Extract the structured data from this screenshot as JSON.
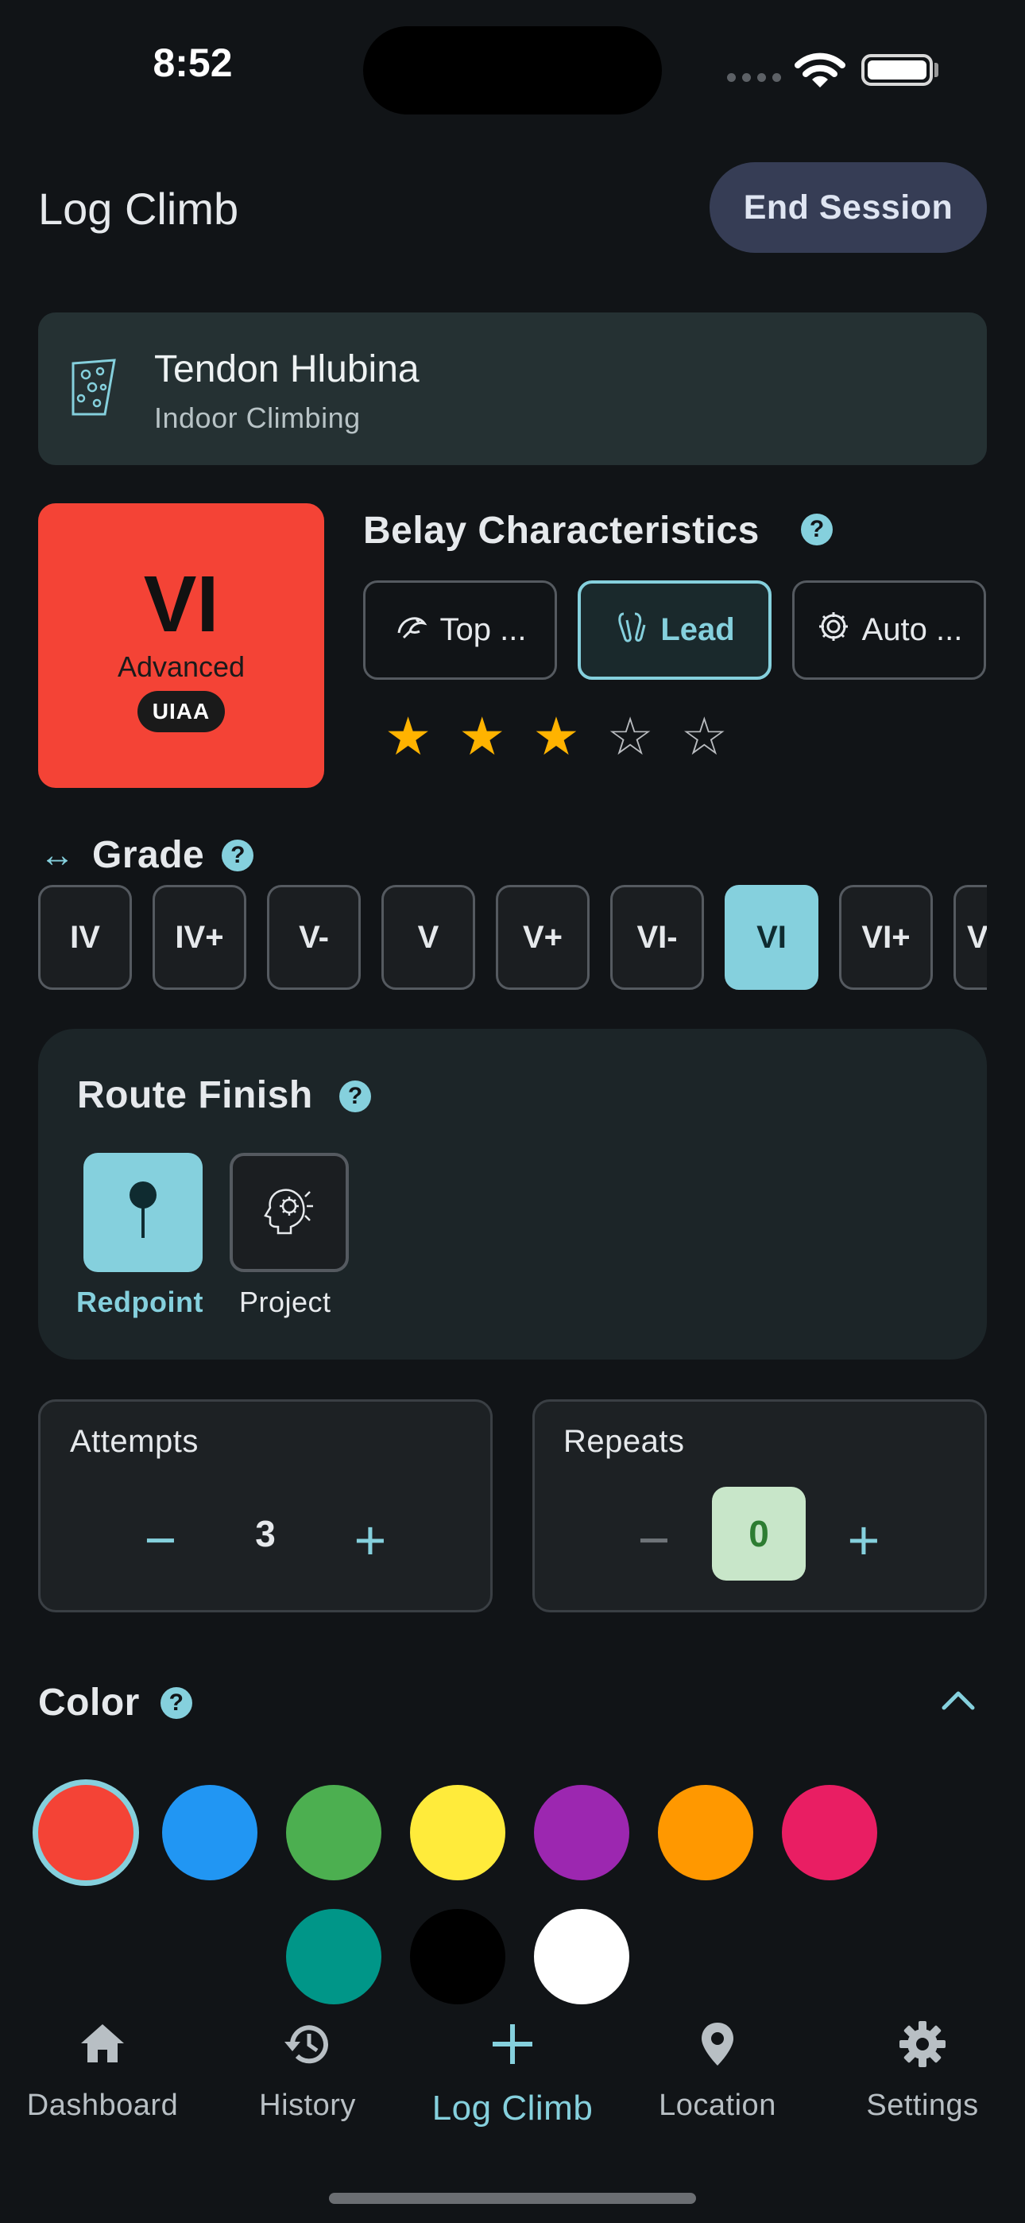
{
  "status_bar": {
    "time": "8:52"
  },
  "header": {
    "title": "Log Climb",
    "end_session_label": "End Session"
  },
  "gym": {
    "name": "Tendon Hlubina",
    "type": "Indoor Climbing"
  },
  "grade_badge": {
    "grade": "VI",
    "level": "Advanced",
    "system": "UIAA",
    "color": "#f44336"
  },
  "belay": {
    "title": "Belay Characteristics",
    "options": [
      {
        "label": "Top ...",
        "icon": "top-rope-icon",
        "selected": false
      },
      {
        "label": "Lead",
        "icon": "lead-icon",
        "selected": true
      },
      {
        "label": "Auto ...",
        "icon": "auto-belay-icon",
        "selected": false
      }
    ],
    "rating": 3,
    "rating_max": 5
  },
  "grade_picker": {
    "label": "Grade",
    "chips": [
      "IV",
      "IV+",
      "V-",
      "V",
      "V+",
      "VI-",
      "VI",
      "VI+",
      "V"
    ],
    "selected": "VI"
  },
  "route_finish": {
    "title": "Route Finish",
    "options": [
      {
        "label": "Redpoint",
        "icon": "pin-icon",
        "selected": true
      },
      {
        "label": "Project",
        "icon": "brain-gear-icon",
        "selected": false
      }
    ]
  },
  "attempts": {
    "label": "Attempts",
    "value": "3"
  },
  "repeats": {
    "label": "Repeats",
    "value": "0"
  },
  "colors": {
    "title": "Color",
    "swatches": [
      "#f44336",
      "#2196f3",
      "#4caf50",
      "#ffeb3b",
      "#9c27b0",
      "#ff9800",
      "#e91e63",
      "#009688",
      "#000000",
      "#ffffff"
    ],
    "selected": "#f44336"
  },
  "nav": {
    "items": [
      {
        "label": "Dashboard",
        "icon": "home-icon"
      },
      {
        "label": "History",
        "icon": "history-icon"
      },
      {
        "label": "Log Climb",
        "icon": "plus-icon",
        "active": true
      },
      {
        "label": "Location",
        "icon": "location-pin-icon"
      },
      {
        "label": "Settings",
        "icon": "gear-icon"
      }
    ]
  },
  "accent_color": "#85d0dd"
}
